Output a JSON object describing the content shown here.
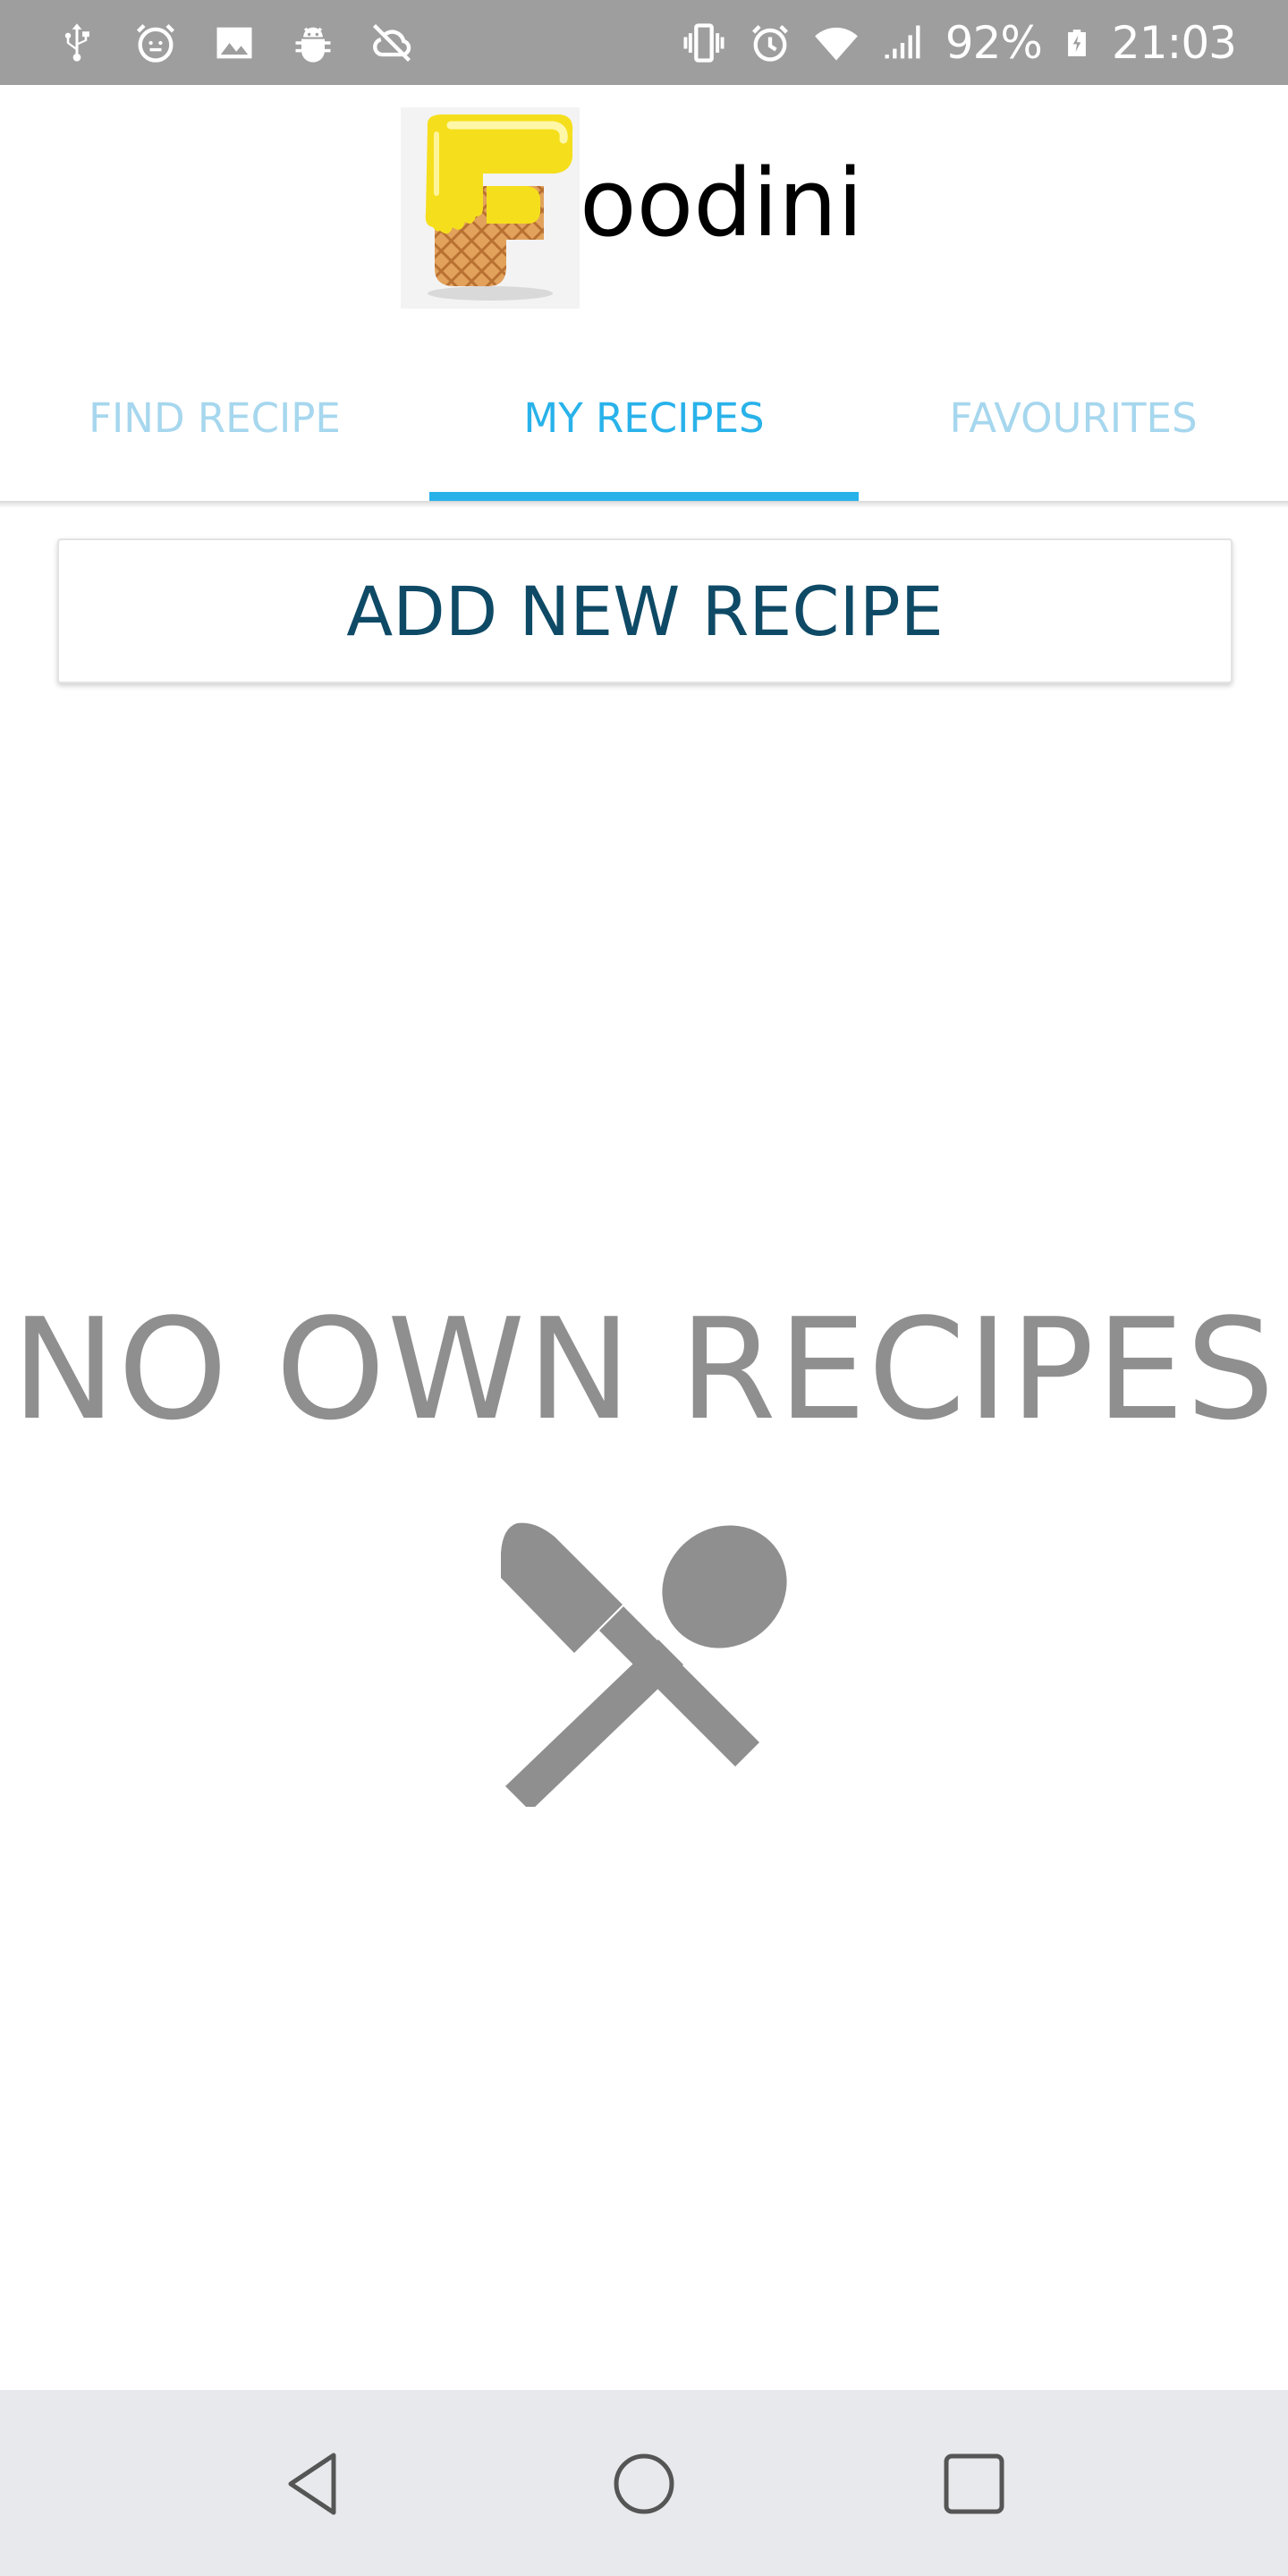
{
  "status_bar": {
    "battery": "92%",
    "time": "21:03",
    "left_icons": [
      "usb-icon",
      "alarm-clock-face-icon",
      "image-icon",
      "android-debug-icon",
      "sync-off-icon"
    ],
    "right_icons": [
      "vibrate-icon",
      "alarm-icon",
      "wifi-icon",
      "signal-icon",
      "battery-charging-icon"
    ]
  },
  "header": {
    "title": "oodini",
    "logo_icon": "waffle-f-logo"
  },
  "tabs": [
    {
      "label": "FIND RECIPE",
      "active": false
    },
    {
      "label": "MY RECIPES",
      "active": true
    },
    {
      "label": "FAVOURITES",
      "active": false
    }
  ],
  "actions": {
    "add_new_recipe": "ADD NEW RECIPE"
  },
  "empty_state": {
    "title": "NO OWN RECIPES",
    "icon": "knife-spoon-icon"
  },
  "nav_bar": {
    "buttons": [
      "back-icon",
      "home-icon",
      "recents-icon"
    ]
  },
  "colors": {
    "accent": "#29b2ea",
    "tab_inactive": "#a6d7ee",
    "button_text": "#0e4a66",
    "empty_text": "#8f8f8f",
    "status_bar": "#9e9e9e",
    "nav_bar": "#e8e9ec"
  }
}
